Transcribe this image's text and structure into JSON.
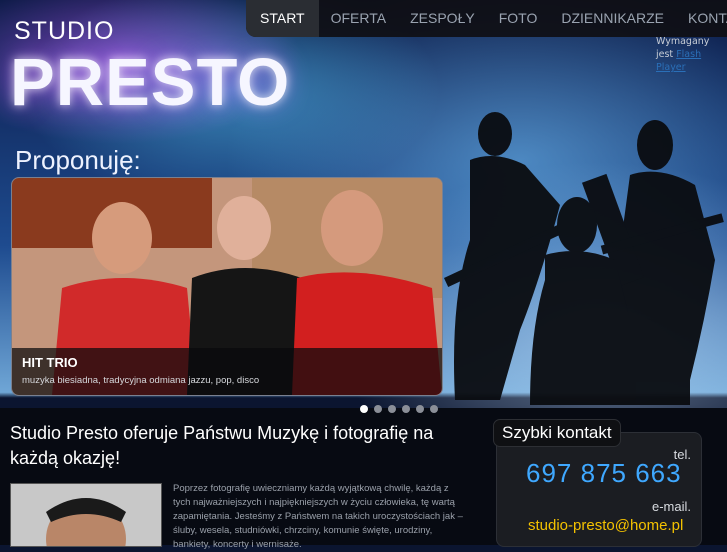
{
  "brand": {
    "studio": "STUDIO",
    "presto": "PRESTO"
  },
  "nav": {
    "items": [
      {
        "label": "START",
        "active": true
      },
      {
        "label": "OFERTA"
      },
      {
        "label": "ZESPOŁY"
      },
      {
        "label": "FOTO"
      },
      {
        "label": "DZIENNIKARZE"
      },
      {
        "label": "KONTAKT"
      }
    ]
  },
  "flash_notice": {
    "prefix": "Wymagany jest",
    "link1": "Flash",
    "link2": "Player"
  },
  "section": {
    "title": "Proponuję:"
  },
  "slider": {
    "caption_title": "HIT TRIO",
    "caption_subtitle": "muzyka biesiadna, tradycyjna odmiana jazzu, pop, disco",
    "dots": 6,
    "active_dot": 1
  },
  "main": {
    "headline": "Studio Presto oferuje Państwu Muzykę i fotografię na każdą okazję!",
    "body": "Poprzez fotografię uwieczniamy każdą wyjątkową chwilę, każdą z tych najważniejszych i najpiękniejszych w życiu człowieka, tę wartą zapamiętania. Jesteśmy z Państwem na takich uroczystościach jak – śluby, wesela, studniówki, chrzciny, komunie święte, urodziny, bankiety, koncerty i wernisaże."
  },
  "contact": {
    "title": "Szybki kontakt",
    "tel_label": "tel.",
    "tel": "697 875 663",
    "mail_label": "e-mail.",
    "mail": "studio-presto@home.pl"
  },
  "colors": {
    "accent_blue": "#3fa8ff",
    "accent_yellow": "#f4c200"
  }
}
